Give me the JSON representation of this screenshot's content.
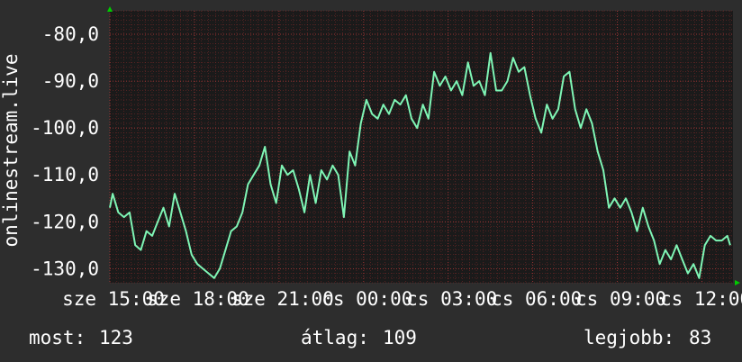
{
  "chart_data": {
    "type": "line",
    "ylabel": "onlinestream.live",
    "ylim": [
      -133,
      -75
    ],
    "ytick_values": [
      -80,
      -90,
      -100,
      -110,
      -120,
      -130
    ],
    "ytick_labels": [
      "-80,0",
      "-90,0",
      "-100,0",
      "-110,0",
      "-120,0",
      "-130,0"
    ],
    "xlim": [
      0,
      22.1
    ],
    "xtick_values": [
      0,
      3,
      6,
      9,
      12,
      15,
      18,
      21
    ],
    "xtick_labels": [
      "sze 15:00",
      "sze 18:00",
      "sze 21:00",
      "cs 00:00",
      "cs 03:00",
      "cs 06:00",
      "cs 09:00",
      "cs 12:00"
    ],
    "grid": true,
    "series": [
      {
        "color": "#7ff5b5",
        "x": [
          0,
          0.1,
          0.3,
          0.5,
          0.7,
          0.9,
          1.1,
          1.3,
          1.5,
          1.7,
          1.9,
          2.1,
          2.3,
          2.5,
          2.7,
          2.9,
          3.1,
          3.3,
          3.5,
          3.7,
          3.9,
          4.1,
          4.3,
          4.5,
          4.7,
          4.9,
          5.1,
          5.3,
          5.5,
          5.7,
          5.9,
          6.1,
          6.3,
          6.5,
          6.7,
          6.9,
          7.1,
          7.3,
          7.5,
          7.7,
          7.9,
          8.1,
          8.3,
          8.5,
          8.7,
          8.9,
          9.1,
          9.3,
          9.5,
          9.7,
          9.9,
          10.1,
          10.3,
          10.5,
          10.7,
          10.9,
          11.1,
          11.3,
          11.5,
          11.7,
          11.9,
          12.1,
          12.3,
          12.5,
          12.7,
          12.9,
          13.1,
          13.3,
          13.5,
          13.7,
          13.9,
          14.1,
          14.3,
          14.5,
          14.7,
          14.9,
          15.1,
          15.3,
          15.5,
          15.7,
          15.9,
          16.1,
          16.3,
          16.5,
          16.7,
          16.9,
          17.1,
          17.3,
          17.5,
          17.7,
          17.9,
          18.1,
          18.3,
          18.5,
          18.7,
          18.9,
          19.1,
          19.3,
          19.5,
          19.7,
          19.9,
          20.1,
          20.3,
          20.5,
          20.7,
          20.9,
          21.1,
          21.3,
          21.5,
          21.7,
          21.9,
          22.0
        ],
        "values": [
          -117,
          -114,
          -118,
          -119,
          -118,
          -125,
          -126,
          -122,
          -123,
          -120,
          -117,
          -121,
          -114,
          -118,
          -122,
          -127,
          -129,
          -130,
          -131,
          -132,
          -130,
          -126,
          -122,
          -121,
          -118,
          -112,
          -110,
          -108,
          -104,
          -112,
          -116,
          -108,
          -110,
          -109,
          -113,
          -118,
          -110,
          -116,
          -109,
          -111,
          -108,
          -110,
          -119,
          -105,
          -108,
          -99,
          -94,
          -97,
          -98,
          -95,
          -97,
          -94,
          -95,
          -93,
          -98,
          -100,
          -95,
          -98,
          -88,
          -91,
          -89,
          -92,
          -90,
          -93,
          -86,
          -91,
          -90,
          -93,
          -84,
          -92,
          -92,
          -90,
          -85,
          -88,
          -87,
          -93,
          -98,
          -101,
          -95,
          -98,
          -96,
          -89,
          -88,
          -96,
          -100,
          -96,
          -99,
          -105,
          -109,
          -117,
          -115,
          -117,
          -115,
          -118,
          -122,
          -117,
          -121,
          -124,
          -129,
          -126,
          -128,
          -125,
          -128,
          -131,
          -129,
          -132,
          -125,
          -123,
          -124,
          -124,
          -123,
          -125
        ]
      }
    ]
  },
  "stats": {
    "current_label": "most:",
    "current_value": "123",
    "average_label": "átlag:",
    "average_value": "109",
    "best_label": "legjobb:",
    "best_value": "83"
  },
  "colors": {
    "background": "#2d2d2d",
    "plot_background": "#1a1a1a",
    "line": "#7ff5b5",
    "grid": "#8a2b2b",
    "axis_arrow": "#00cc00",
    "text": "#ffffff"
  }
}
